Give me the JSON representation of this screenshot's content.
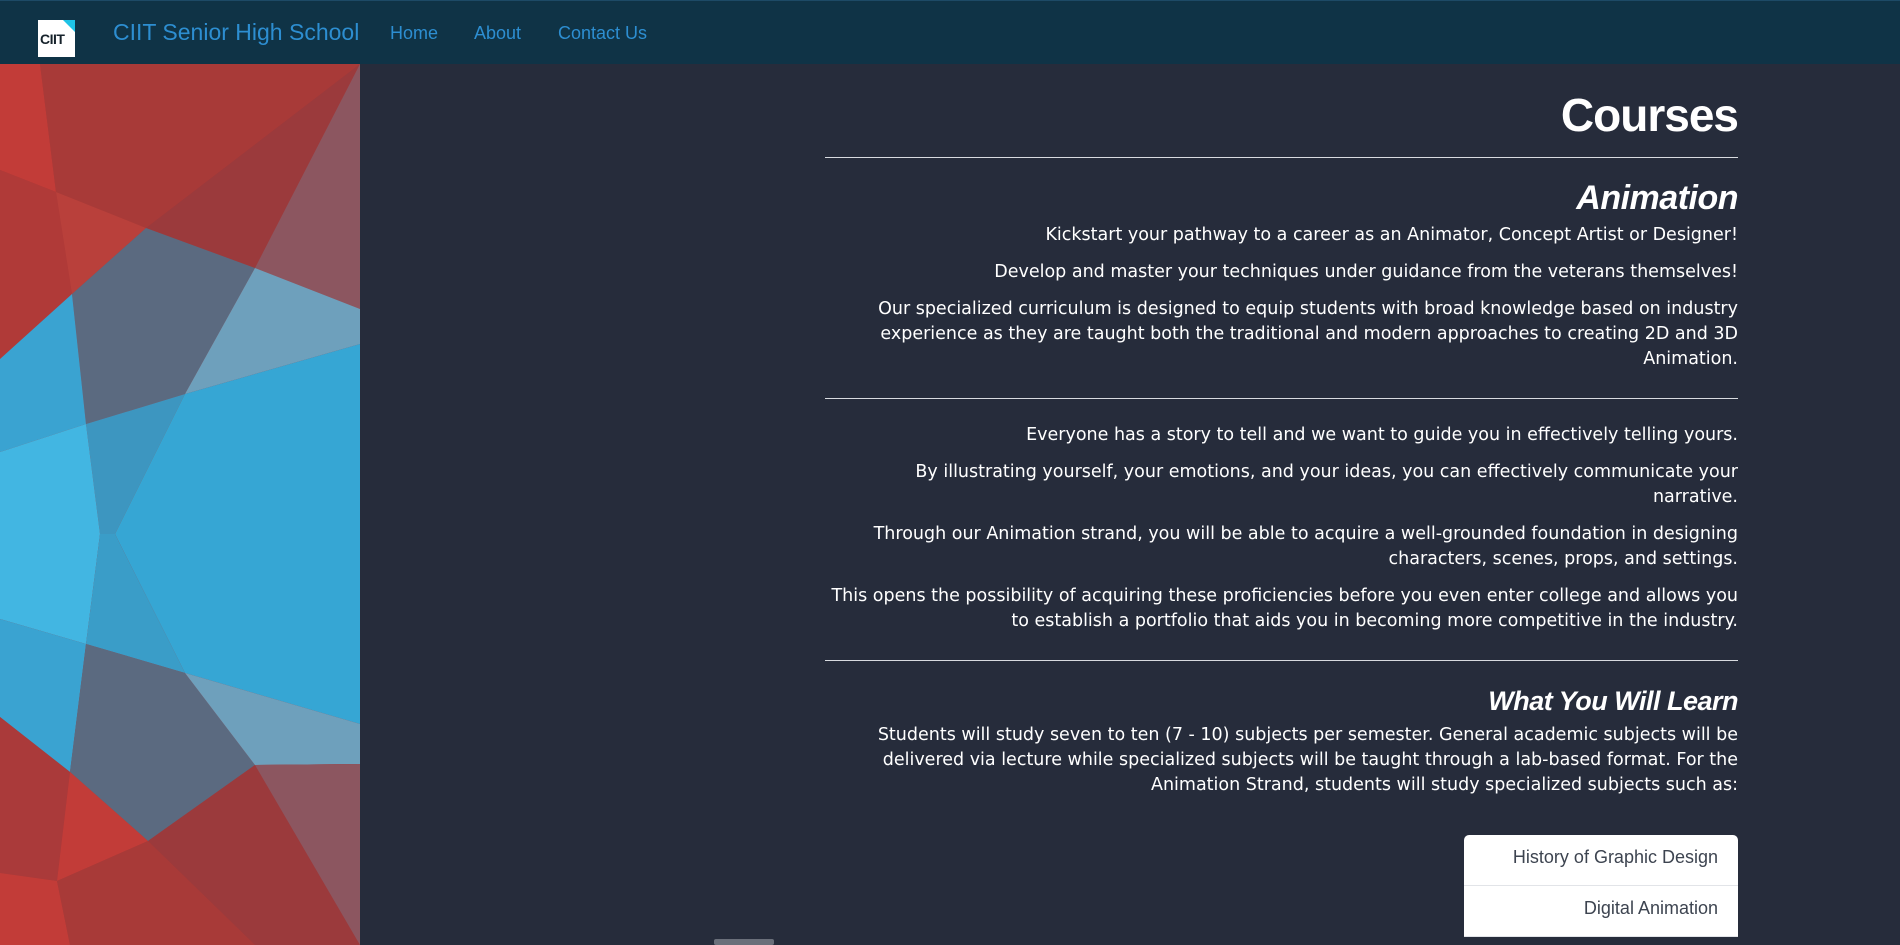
{
  "navbar": {
    "logo_text": "CIIT",
    "brand": "CIIT Senior High School",
    "links": [
      {
        "label": "Home"
      },
      {
        "label": "About"
      },
      {
        "label": "Contact Us"
      }
    ]
  },
  "main": {
    "title": "Courses",
    "animation": {
      "heading": "Animation",
      "intro": [
        "Kickstart your pathway to a career as an Animator, Concept Artist or Designer!",
        "Develop and master your techniques under guidance from the veterans themselves!",
        "Our specialized curriculum is designed to equip students with broad knowledge based on industry experience as they are taught both the traditional and modern approaches to creating 2D and 3D Animation."
      ],
      "story": [
        "Everyone has a story to tell and we want to guide you in effectively telling yours.",
        "By illustrating yourself, your emotions, and your ideas, you can effectively communicate your narrative.",
        "Through our Animation strand, you will be able to acquire a well-grounded foundation in designing characters, scenes, props, and settings.",
        "This opens the possibility of acquiring these proficiencies before you even enter college and allows you to establish a portfolio that aids you in becoming more competitive in the industry."
      ]
    },
    "learn": {
      "heading": "What You Will Learn",
      "description": "Students will study seven to ten (7 - 10) subjects per semester. General academic subjects will be delivered via lecture while specialized subjects will be taught through a lab-based format. For the Animation Strand, students will study specialized subjects such as:",
      "subjects": [
        "History of Graphic Design",
        "Digital Animation"
      ]
    }
  },
  "colors": {
    "navbar_bg": "#0f3346",
    "page_bg": "#262c3b",
    "link": "#2d8ed1",
    "text": "#ffffff"
  }
}
